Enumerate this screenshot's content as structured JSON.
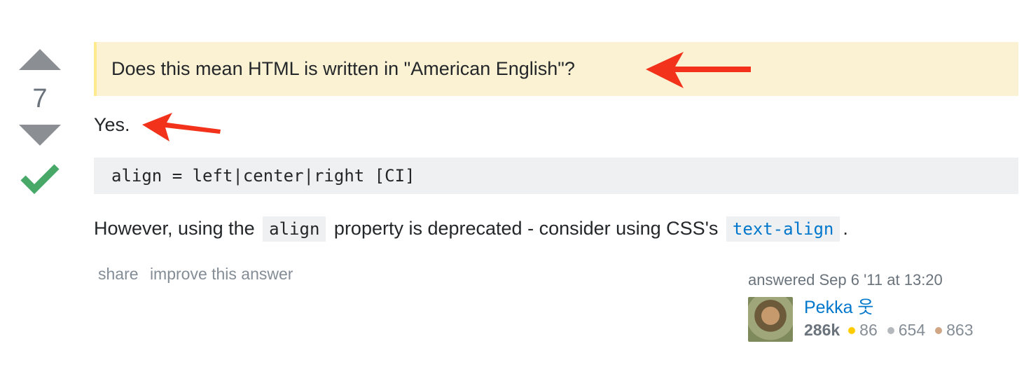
{
  "vote": {
    "score": "7"
  },
  "answer": {
    "quote": "Does this mean HTML is written in \"American English\"?",
    "yes": "Yes.",
    "code_block": "align = left|center|right [CI]",
    "para_prefix": "However, using the",
    "inline_code_1": "align",
    "para_middle": "property is deprecated - consider using CSS's",
    "inline_code_2": "text-align",
    "para_suffix": "."
  },
  "menu": {
    "share": "share",
    "improve": "improve this answer"
  },
  "signature": {
    "answered": "answered Sep 6 '11 at 13:20",
    "username": "Pekka 웃",
    "reputation": "286k",
    "gold": "86",
    "silver": "654",
    "bronze": "863"
  },
  "colors": {
    "upvote": "#8b8f93",
    "accepted": "#48a868",
    "arrow": "#f2321b",
    "gold": "#ffcc01",
    "silver": "#b4b8bc",
    "bronze": "#d1a684"
  },
  "icons": {
    "upvote": "triangle-up",
    "downvote": "triangle-down",
    "accepted": "checkmark",
    "annotation": "red-arrow"
  }
}
